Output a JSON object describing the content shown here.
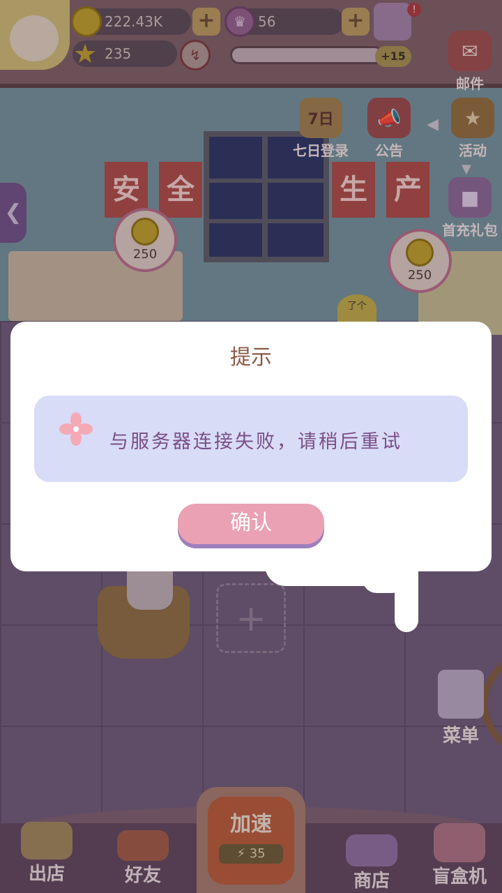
{
  "hud": {
    "coins": "222.43K",
    "stars": "235",
    "gems": "56",
    "level_bonus": "+15",
    "plus": "+",
    "broom_icon": "broom-icon"
  },
  "side_buttons": {
    "mail": "邮件",
    "seven_day": "七日登录",
    "seven_day_badge": "7日",
    "notice": "公告",
    "activity": "活动",
    "first_recharge": "首充礼包"
  },
  "scene": {
    "banner_left": [
      "安",
      "全"
    ],
    "banner_right": [
      "生",
      "产"
    ],
    "bubble_left": "250",
    "bubble_right": "250",
    "npc_bubble": "了个",
    "add_slot": "+",
    "menu": "菜单"
  },
  "bottom_nav": {
    "out_shop": "出店",
    "friends": "好友",
    "speed_up": "加速",
    "speed_cost": "35",
    "shop": "商店",
    "blind_box": "盲盒机"
  },
  "dialog": {
    "title": "提示",
    "message": "与服务器连接失败，请稍后重试",
    "confirm": "确认"
  },
  "colors": {
    "dialog_bg": "#ffffff",
    "message_bg": "#d8dcf6",
    "message_text": "#7a4e86",
    "title_text": "#8a5a45",
    "confirm_bg": "#eaa1b3",
    "confirm_shadow": "#9d7fbd"
  }
}
